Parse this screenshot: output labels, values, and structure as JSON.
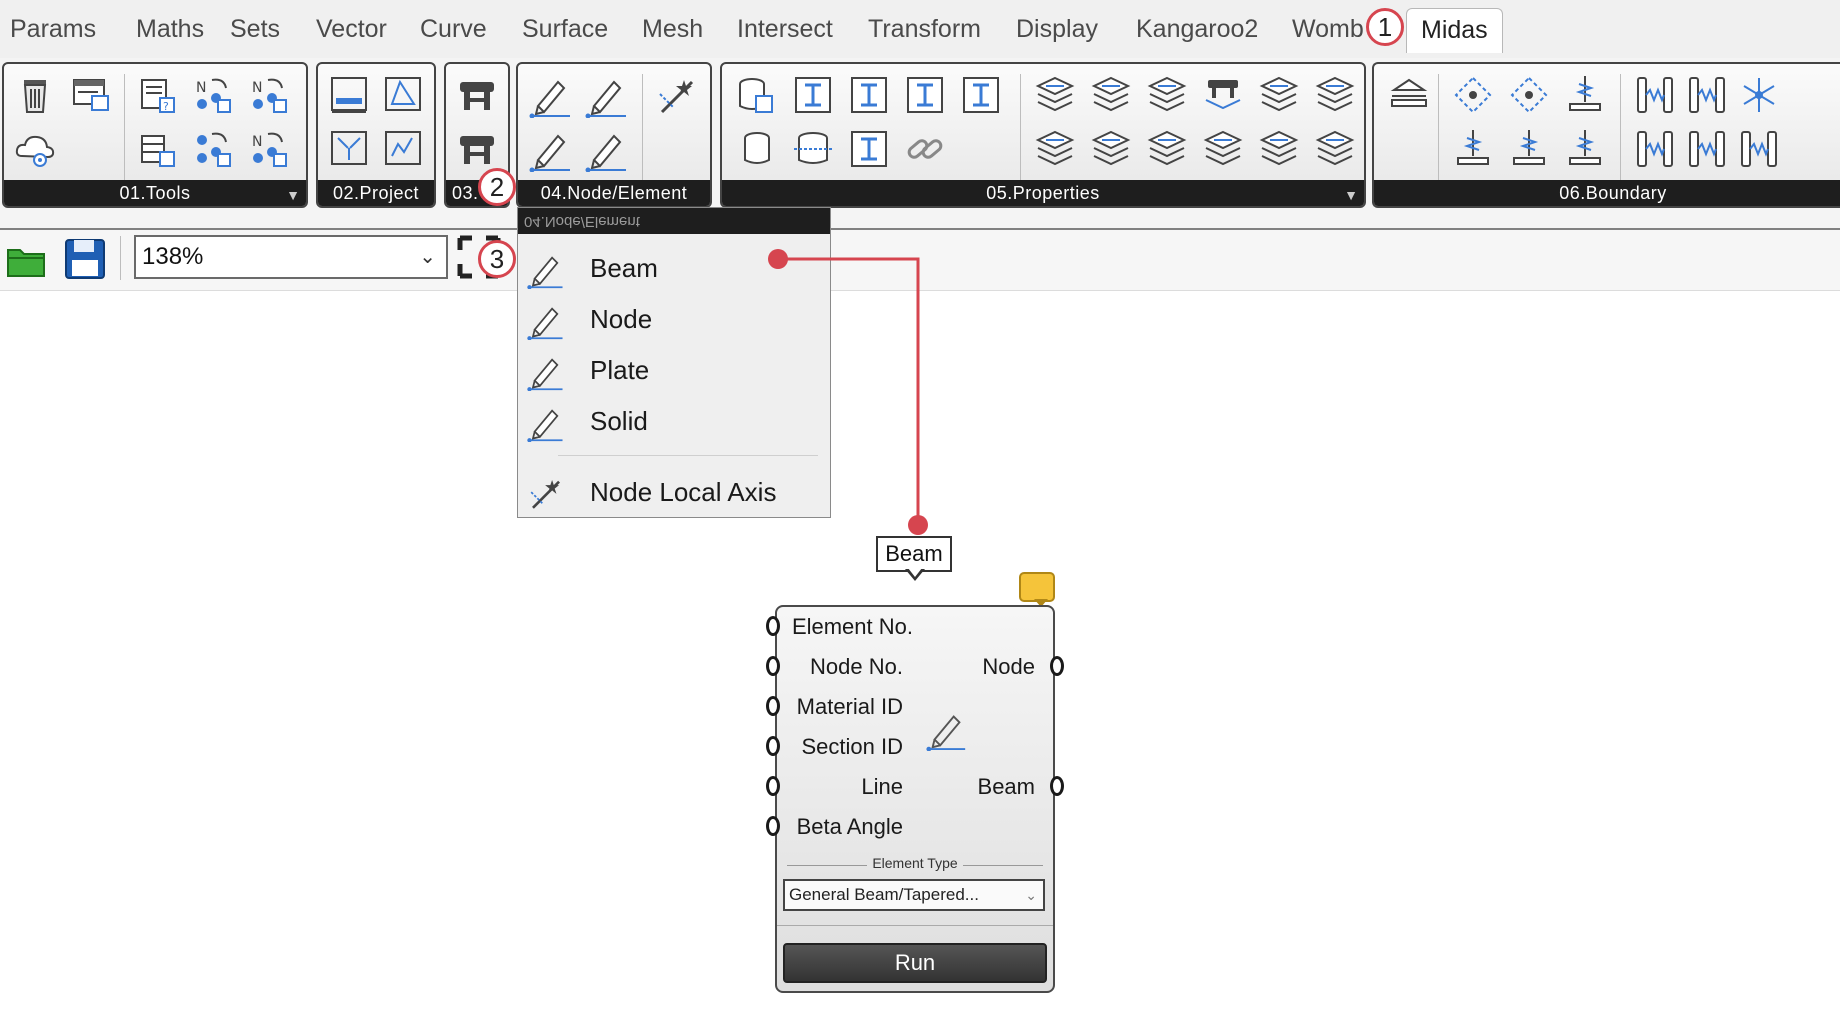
{
  "menu": {
    "tabs": [
      "Params",
      "Maths",
      "Sets",
      "Vector",
      "Curve",
      "Surface",
      "Mesh",
      "Intersect",
      "Transform",
      "Display",
      "Kangaroo2",
      "Womb"
    ],
    "active_tab": "Midas"
  },
  "ribbon": {
    "groups": {
      "tools": "01.Tools",
      "project": "02.Project",
      "g03": "03.",
      "node_element": "04.Node/Element",
      "properties": "05.Properties",
      "boundary": "06.Boundary"
    }
  },
  "toolbar": {
    "zoom_value": "138%"
  },
  "callouts": {
    "c1": "1",
    "c2": "2",
    "c3": "3"
  },
  "dropdown": {
    "header": "04.Node/Element",
    "items": [
      {
        "label": "Beam",
        "icon": "pencil-icon"
      },
      {
        "label": "Node",
        "icon": "pencil-icon"
      },
      {
        "label": "Plate",
        "icon": "pencil-icon"
      },
      {
        "label": "Solid",
        "icon": "pencil-icon"
      },
      {
        "label": "Node Local Axis",
        "icon": "axis-wand-icon"
      }
    ]
  },
  "tooltip": {
    "text": "Beam"
  },
  "component": {
    "inputs": [
      "Element No.",
      "Node No.",
      "Material ID",
      "Section ID",
      "Line",
      "Beta Angle"
    ],
    "outputs": {
      "node": "Node",
      "beam": "Beam"
    },
    "element_type_label": "Element Type",
    "element_type_value": "General  Beam/Tapered...",
    "run_label": "Run"
  },
  "colors": {
    "callout_red": "#d6454f",
    "icon_blue": "#3a7bd5",
    "ribbon_label_bg": "#1e1e1e"
  }
}
